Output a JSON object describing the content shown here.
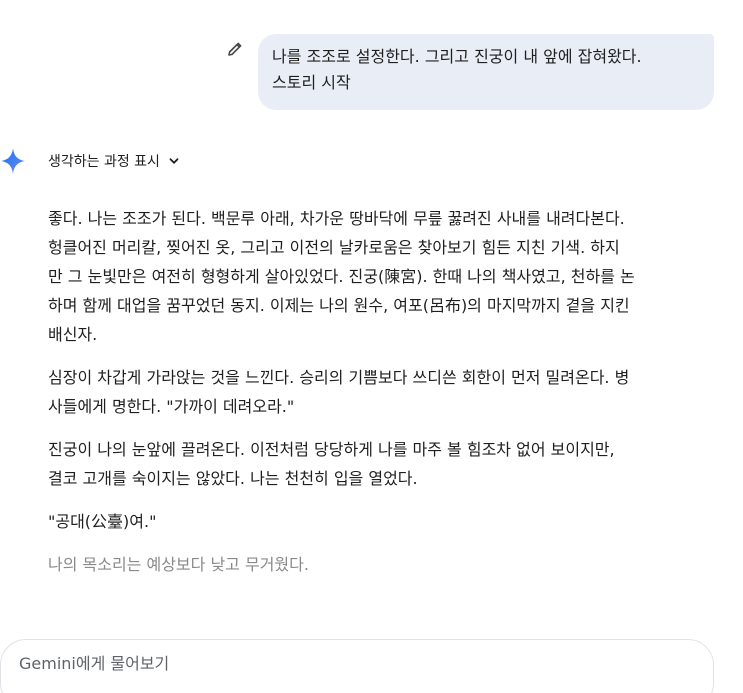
{
  "user_message": {
    "lines": [
      "나를 조조로 설정한다. 그리고 진궁이 내 앞에 잡혀왔다.",
      "스토리 시작"
    ],
    "edit_icon": "pencil-icon"
  },
  "response": {
    "thinking_toggle_label": "생각하는 과정 표시",
    "thinking_icon": "chevron-down-icon",
    "avatar_icon": "gemini-spark-icon",
    "paragraphs": [
      {
        "lines": [
          "좋다. 나는 조조가 된다. 백문루 아래, 차가운 땅바닥에 무릎 꿇려진 사내를 내려다본다.",
          "헝클어진 머리칼, 찢어진 옷, 그리고 이전의 날카로움은 찾아보기 힘든 지친 기색. 하지",
          "만 그 눈빛만은 여전히 형형하게 살아있었다. 진궁(陳宮). 한때 나의 책사였고, 천하를 논",
          "하며 함께 대업을 꿈꾸었던 동지. 이제는 나의 원수, 여포(呂布)의 마지막까지 곁을 지킨",
          "배신자."
        ]
      },
      {
        "lines": [
          "심장이 차갑게 가라앉는 것을 느낀다. 승리의 기쁨보다 쓰디쓴 회한이 먼저 밀려온다. 병",
          "사들에게 명한다. \"가까이 데려오라.\""
        ]
      },
      {
        "lines": [
          "진궁이 나의 눈앞에 끌려온다. 이전처럼 당당하게 나를 마주 볼 힘조차 없어 보이지만,",
          "결코 고개를 숙이지는 않았다. 나는 천천히 입을 열었다."
        ]
      },
      {
        "lines": [
          "\"공대(公臺)여.\""
        ]
      },
      {
        "lines": [
          "나의 목소리는 예상보다 낮고 무거웠다."
        ]
      }
    ]
  },
  "input": {
    "placeholder": "Gemini에게 물어보기",
    "value": ""
  },
  "colors": {
    "user_bubble_bg": "#e9eef6",
    "text": "#1f1f1f",
    "muted_text": "#8a8a8a",
    "spark_blue": "#4285f4"
  }
}
